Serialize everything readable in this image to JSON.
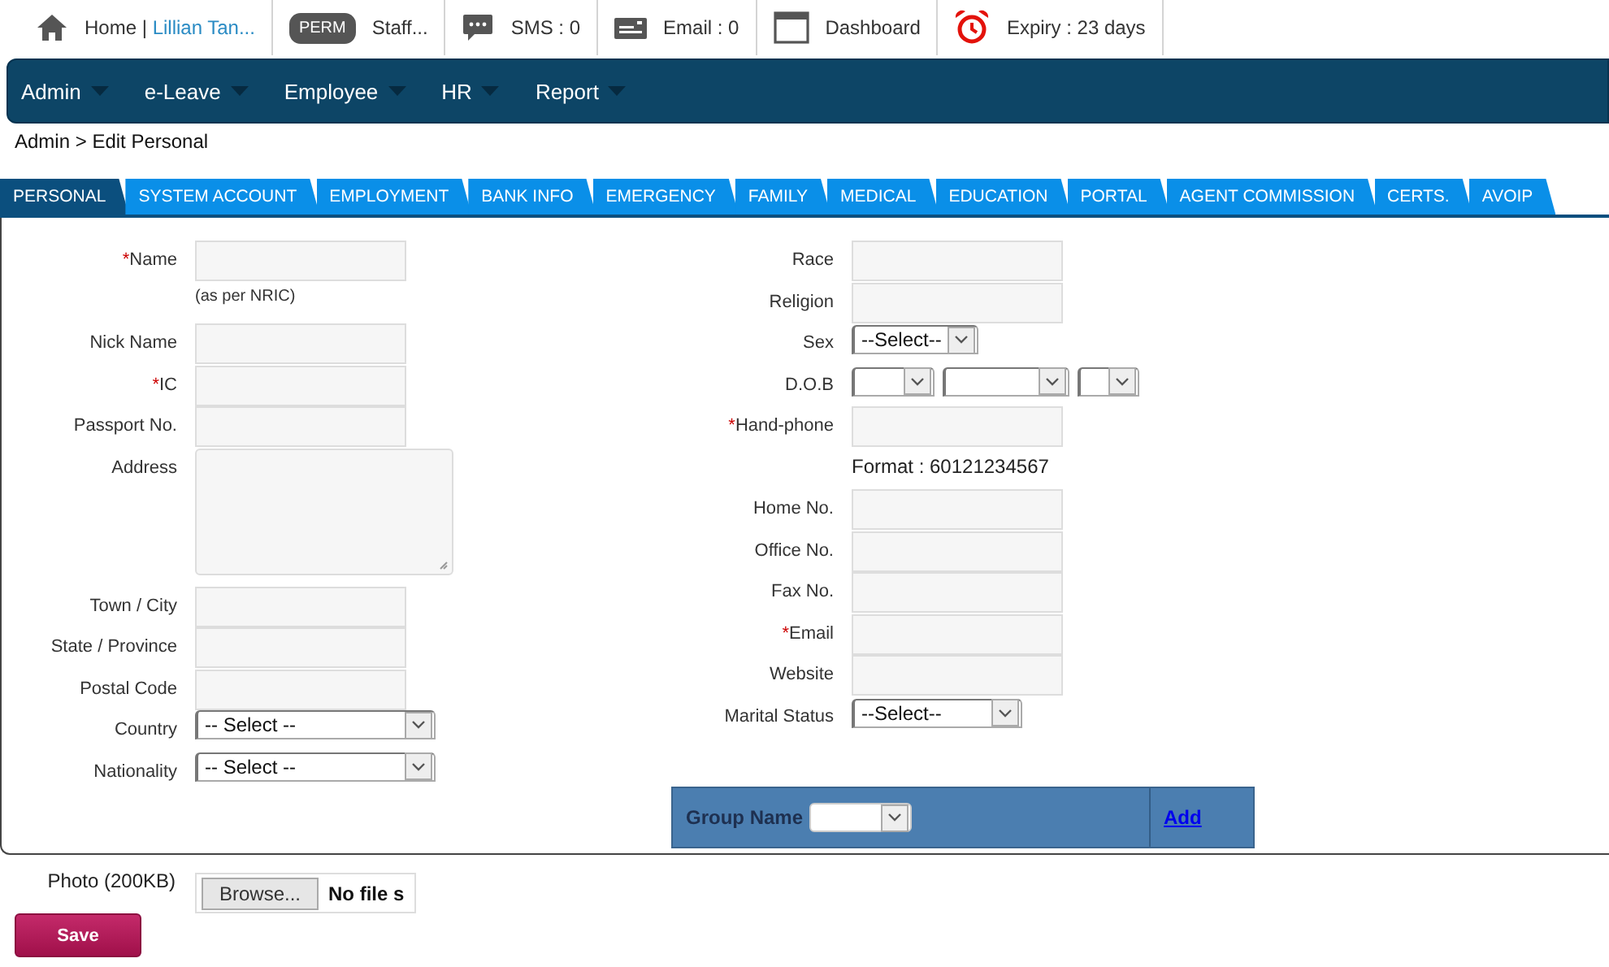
{
  "top_bar": [
    {
      "kind": "home",
      "label": "Home |",
      "link": "Lillian Tan..."
    },
    {
      "kind": "badge",
      "badge": "PERM",
      "label": "Staff..."
    },
    {
      "kind": "sms",
      "label": "SMS : 0"
    },
    {
      "kind": "email",
      "label": "Email : 0"
    },
    {
      "kind": "dashboard",
      "label": "Dashboard"
    },
    {
      "kind": "expiry",
      "label": "Expiry : 23 days"
    }
  ],
  "nav": [
    "Admin",
    "e-Leave",
    "Employee",
    "HR",
    "Report"
  ],
  "breadcrumb": "Admin > Edit Personal",
  "tabs": [
    {
      "label": "PERSONAL",
      "selected": true
    },
    {
      "label": "SYSTEM ACCOUNT",
      "selected": false
    },
    {
      "label": "EMPLOYMENT",
      "selected": false
    },
    {
      "label": "BANK INFO",
      "selected": false
    },
    {
      "label": "EMERGENCY",
      "selected": false
    },
    {
      "label": "FAMILY",
      "selected": false
    },
    {
      "label": "MEDICAL",
      "selected": false
    },
    {
      "label": "EDUCATION",
      "selected": false
    },
    {
      "label": "PORTAL",
      "selected": false
    },
    {
      "label": "AGENT COMMISSION",
      "selected": false
    },
    {
      "label": "CERTS.",
      "selected": false
    },
    {
      "label": "AVOIP",
      "selected": false
    }
  ],
  "left_fields": [
    {
      "kind": "text",
      "label": "Name",
      "required_mark": "*"
    },
    {
      "kind": "note",
      "text": "(as per NRIC)"
    },
    {
      "kind": "text",
      "label": "Nick Name"
    },
    {
      "kind": "text",
      "label": "IC",
      "required_mark": "*"
    },
    {
      "kind": "text",
      "label": "Passport No."
    },
    {
      "kind": "textarea",
      "label": "Address"
    },
    {
      "kind": "text",
      "label": "Town / City"
    },
    {
      "kind": "text",
      "label": "State / Province"
    },
    {
      "kind": "text",
      "label": "Postal Code"
    },
    {
      "kind": "select",
      "label": "Country",
      "value": "-- Select --"
    },
    {
      "kind": "select",
      "label": "Nationality",
      "value": "-- Select --"
    }
  ],
  "right_fields": [
    {
      "kind": "text",
      "label": "Race"
    },
    {
      "kind": "text",
      "label": "Religion"
    },
    {
      "kind": "select_small",
      "label": "Sex",
      "value": "--Select--"
    },
    {
      "kind": "date",
      "label": "D.O.B"
    },
    {
      "kind": "text",
      "label": "Hand-phone",
      "required_mark": "*"
    },
    {
      "kind": "format",
      "text": "Format : 60121234567"
    },
    {
      "kind": "text",
      "label": "Home No."
    },
    {
      "kind": "text",
      "label": "Office No."
    },
    {
      "kind": "text",
      "label": "Fax No."
    },
    {
      "kind": "text",
      "label": "Email",
      "required_mark": "*"
    },
    {
      "kind": "text",
      "label": "Website"
    },
    {
      "kind": "select_mid",
      "label": "Marital Status",
      "value": "--Select--"
    }
  ],
  "group": {
    "label": "Group Name",
    "link": "Add"
  },
  "photo": {
    "label": "Photo (200KB)",
    "button": "Browse...",
    "status": "No file s"
  },
  "save": "Save"
}
